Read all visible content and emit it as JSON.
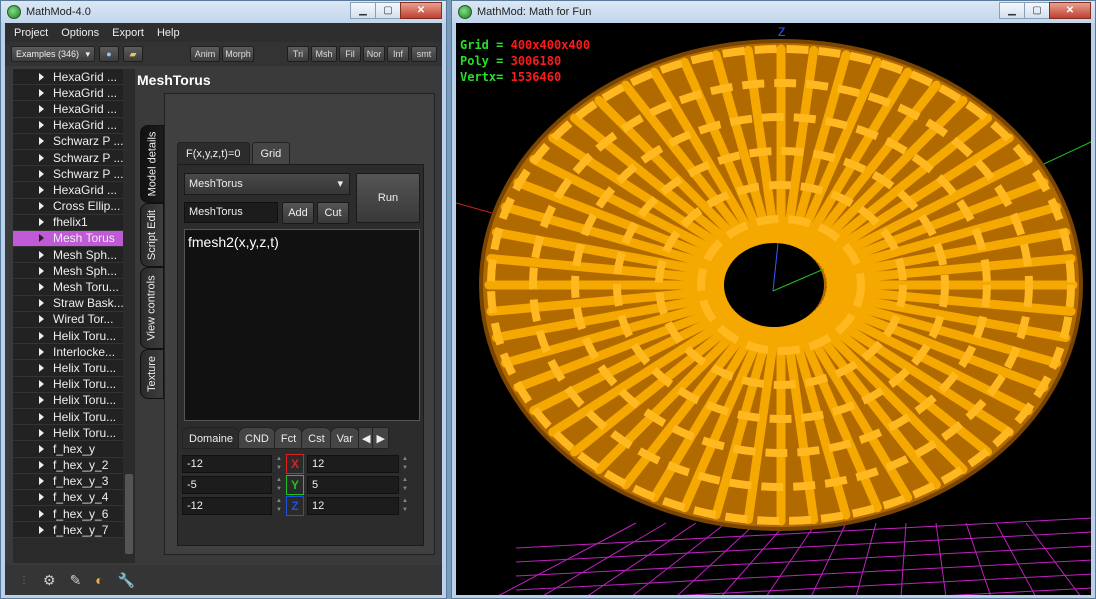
{
  "left_window": {
    "title": "MathMod-4.0",
    "menu": [
      "Project",
      "Options",
      "Export",
      "Help"
    ],
    "toolbar": {
      "examples_label": "Examples (346)",
      "buttons": [
        "Anim",
        "Morph",
        "Tri",
        "Msh",
        "Fil",
        "Nor",
        "Inf",
        "smt"
      ]
    },
    "tree": {
      "items": [
        "HexaGrid ...",
        "HexaGrid ...",
        "HexaGrid ...",
        "HexaGrid ...",
        "Schwarz P ...",
        "Schwarz P ...",
        "Schwarz P ...",
        "HexaGrid ...",
        "Cross Ellip...",
        "fhelix1",
        "Mesh Torus",
        "Mesh Sph...",
        "Mesh Sph...",
        "Mesh Toru...",
        "Straw Bask...",
        "Wired Tor...",
        "Helix Toru...",
        "Interlocke...",
        "Helix Toru...",
        "Helix Toru...",
        "Helix Toru...",
        "Helix Toru...",
        "Helix Toru...",
        "f_hex_y",
        "f_hex_y_2",
        "f_hex_y_3",
        "f_hex_y_4",
        "f_hex_y_6",
        "f_hex_y_7"
      ],
      "selected_index": 10
    },
    "model_title": "MeshTorus",
    "side_tabs": [
      "Model details",
      "Script Edit",
      "View controls",
      "Texture"
    ],
    "top_tabs": [
      "F(x,y,z,t)=0",
      "Grid"
    ],
    "function_select": "MeshTorus",
    "name_value": "MeshTorus",
    "add_label": "Add",
    "cut_label": "Cut",
    "run_label": "Run",
    "equation": "fmesh2(x,y,z,t)",
    "bottom_tabs": [
      "Domaine",
      "CND",
      "Fct",
      "Cst",
      "Var"
    ],
    "domain": [
      {
        "axis": "X",
        "min": "-12",
        "max": "12",
        "color": "#e02020"
      },
      {
        "axis": "Y",
        "min": "-5",
        "max": "5",
        "color": "#20c020"
      },
      {
        "axis": "Z",
        "min": "-12",
        "max": "12",
        "color": "#2050e0"
      }
    ]
  },
  "right_window": {
    "title": "MathMod: Math for Fun",
    "hud": [
      {
        "key": "Grid =",
        "value": "400x400x400"
      },
      {
        "key": "Poly =",
        "value": "3006180"
      },
      {
        "key": "Vertx=",
        "value": "1536460"
      }
    ],
    "axis_label": "Z",
    "accent": "#f5a800"
  }
}
